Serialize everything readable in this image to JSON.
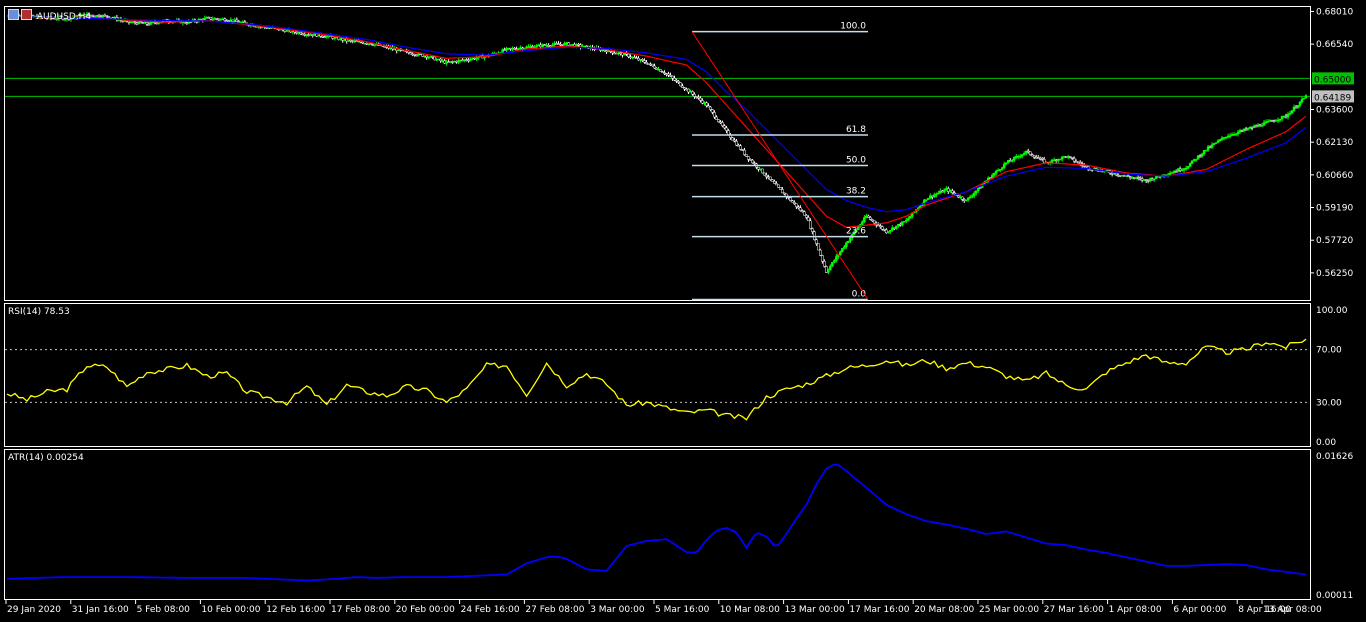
{
  "window": {
    "symbol_title": "AUDUSD,H4"
  },
  "colors": {
    "background": "#000000",
    "bull_candle": "#00ff00",
    "bear_candle": "#ffffff",
    "ma_fast": "#ff0000",
    "ma_slow": "#0000ff",
    "fib_lines": "#c0e0f0",
    "price_level_lines": "#00c000",
    "rsi_line": "#ffff00",
    "atr_line": "#0000ff",
    "frame": "#ffffff"
  },
  "price_badges": [
    {
      "label": "0.65000",
      "bg": "#00c000",
      "fg": "#000000",
      "value": 0.65
    },
    {
      "label": "0.64189",
      "bg": "#c0c0c0",
      "fg": "#000000",
      "value": 0.64189
    }
  ],
  "fibonacci": {
    "levels": [
      {
        "label": "100.0",
        "value": 0.671
      },
      {
        "label": "61.8",
        "value": 0.6245
      },
      {
        "label": "50.0",
        "value": 0.6108
      },
      {
        "label": "38.2",
        "value": 0.5968
      },
      {
        "label": "23.6",
        "value": 0.5788
      },
      {
        "label": "0.0",
        "value": 0.5505
      }
    ]
  },
  "rsi_panel": {
    "title": "RSI(14) 78.53",
    "levels_dashed": [
      70,
      30
    ]
  },
  "atr_panel": {
    "title": "ATR(14) 0.00254"
  },
  "chart_data": [
    {
      "type": "line",
      "title": "AUDUSD,H4",
      "description_series": "candlestick price with two moving averages",
      "ylim": [
        0.5503,
        0.6821
      ],
      "y_ticks": [
        "0.68010",
        "0.66540",
        "0.63600",
        "0.62130",
        "0.60660",
        "0.59190",
        "0.57720",
        "0.56250"
      ],
      "x_ticks": [
        "29 Jan 2020",
        "31 Jan 16:00",
        "5 Feb 08:00",
        "10 Feb 00:00",
        "12 Feb 16:00",
        "17 Feb 08:00",
        "20 Feb 00:00",
        "24 Feb 16:00",
        "27 Feb 08:00",
        "3 Mar 00:00",
        "5 Mar 16:00",
        "10 Mar 08:00",
        "13 Mar 00:00",
        "17 Mar 16:00",
        "20 Mar 08:00",
        "25 Mar 00:00",
        "27 Mar 16:00",
        "1 Apr 08:00",
        "6 Apr 00:00",
        "8 Apr 16:00",
        "13 Apr 08:00"
      ],
      "series": [
        {
          "role": "close",
          "x": [
            0,
            10,
            20,
            30,
            40,
            50,
            60,
            70,
            80,
            90,
            100,
            110,
            120,
            130,
            140,
            150,
            160,
            170,
            180,
            190,
            200,
            210,
            220,
            230,
            240,
            250,
            260,
            270,
            280,
            290,
            300,
            310,
            320,
            330,
            340,
            350,
            360,
            370,
            380,
            390,
            400,
            410,
            420,
            430,
            440,
            450,
            460,
            470,
            480,
            490,
            500,
            510,
            520,
            530,
            540,
            550,
            560,
            570,
            580,
            590,
            600,
            610,
            620,
            630,
            640,
            650
          ],
          "values": [
            0.6785,
            0.6778,
            0.6772,
            0.677,
            0.6785,
            0.678,
            0.6755,
            0.6745,
            0.676,
            0.6752,
            0.677,
            0.6765,
            0.6745,
            0.673,
            0.6715,
            0.67,
            0.669,
            0.667,
            0.666,
            0.664,
            0.6618,
            0.66,
            0.657,
            0.6585,
            0.66,
            0.663,
            0.664,
            0.665,
            0.6655,
            0.664,
            0.6625,
            0.6605,
            0.657,
            0.652,
            0.645,
            0.638,
            0.626,
            0.615,
            0.606,
            0.597,
            0.588,
            0.563,
            0.576,
            0.588,
            0.581,
            0.586,
            0.596,
            0.6,
            0.595,
            0.604,
            0.612,
            0.617,
            0.612,
            0.615,
            0.61,
            0.608,
            0.606,
            0.604,
            0.607,
            0.61,
            0.618,
            0.624,
            0.627,
            0.63,
            0.633,
            0.6419
          ]
        },
        {
          "role": "ma_fast",
          "x": [
            0,
            20,
            40,
            60,
            80,
            100,
            120,
            140,
            160,
            180,
            200,
            220,
            240,
            260,
            280,
            300,
            320,
            340,
            350,
            360,
            370,
            380,
            390,
            400,
            410,
            420,
            430,
            440,
            450,
            460,
            480,
            500,
            520,
            540,
            560,
            580,
            600,
            620,
            640,
            650
          ],
          "values": [
            0.6778,
            0.6772,
            0.6775,
            0.6762,
            0.6752,
            0.676,
            0.6742,
            0.672,
            0.6695,
            0.6665,
            0.6625,
            0.659,
            0.6598,
            0.6632,
            0.6645,
            0.663,
            0.66,
            0.656,
            0.648,
            0.638,
            0.628,
            0.618,
            0.608,
            0.598,
            0.588,
            0.583,
            0.584,
            0.585,
            0.588,
            0.593,
            0.599,
            0.608,
            0.612,
            0.611,
            0.6075,
            0.606,
            0.609,
            0.618,
            0.626,
            0.633
          ]
        },
        {
          "role": "ma_slow",
          "x": [
            0,
            20,
            40,
            60,
            80,
            100,
            120,
            140,
            160,
            180,
            200,
            220,
            240,
            260,
            280,
            300,
            320,
            340,
            350,
            360,
            370,
            380,
            390,
            400,
            410,
            420,
            430,
            440,
            450,
            460,
            480,
            500,
            520,
            540,
            560,
            580,
            600,
            620,
            640,
            650
          ],
          "values": [
            0.6775,
            0.6775,
            0.677,
            0.6765,
            0.676,
            0.6758,
            0.6745,
            0.6725,
            0.67,
            0.6675,
            0.664,
            0.661,
            0.6605,
            0.6625,
            0.664,
            0.6635,
            0.6615,
            0.6585,
            0.653,
            0.644,
            0.636,
            0.627,
            0.618,
            0.609,
            0.6,
            0.595,
            0.592,
            0.59,
            0.591,
            0.594,
            0.599,
            0.606,
            0.61,
            0.6095,
            0.607,
            0.606,
            0.608,
            0.614,
            0.621,
            0.628
          ]
        }
      ]
    },
    {
      "type": "line",
      "title": "RSI(14) 78.53",
      "ylim": [
        0,
        100
      ],
      "y_ticks": [
        "100.00",
        "70.00",
        "30.00",
        "0.00"
      ],
      "series": [
        {
          "name": "RSI(14)",
          "x": [
            0,
            10,
            20,
            30,
            40,
            50,
            60,
            70,
            80,
            90,
            100,
            110,
            120,
            130,
            140,
            150,
            160,
            170,
            180,
            190,
            200,
            210,
            220,
            230,
            240,
            250,
            260,
            270,
            280,
            290,
            300,
            310,
            320,
            330,
            340,
            350,
            360,
            370,
            380,
            390,
            400,
            410,
            420,
            430,
            440,
            450,
            460,
            470,
            480,
            490,
            500,
            510,
            520,
            530,
            540,
            550,
            560,
            570,
            580,
            590,
            600,
            610,
            620,
            630,
            640,
            650
          ],
          "values": [
            37,
            32,
            38,
            40,
            58,
            57,
            42,
            53,
            55,
            58,
            50,
            52,
            38,
            34,
            30,
            42,
            28,
            43,
            38,
            35,
            42,
            39,
            30,
            40,
            58,
            58,
            36,
            60,
            43,
            52,
            44,
            28,
            30,
            26,
            22,
            24,
            20,
            18,
            34,
            40,
            44,
            50,
            56,
            58,
            62,
            58,
            62,
            56,
            60,
            57,
            50,
            46,
            52,
            43,
            40,
            53,
            60,
            66,
            60,
            60,
            72,
            68,
            70,
            76,
            72,
            78
          ]
        }
      ]
    },
    {
      "type": "line",
      "title": "ATR(14) 0.00254",
      "ylim": [
        0,
        0.01626
      ],
      "y_ticks": [
        "0.01626",
        "0.00011"
      ],
      "series": [
        {
          "name": "ATR(14)",
          "x": [
            0,
            30,
            60,
            90,
            120,
            150,
            165,
            175,
            185,
            200,
            220,
            250,
            260,
            270,
            275,
            280,
            290,
            300,
            310,
            320,
            330,
            340,
            345,
            350,
            355,
            360,
            365,
            370,
            375,
            380,
            385,
            390,
            395,
            400,
            405,
            410,
            415,
            420,
            430,
            440,
            450,
            460,
            470,
            480,
            490,
            500,
            510,
            520,
            530,
            540,
            550,
            560,
            570,
            580,
            590,
            600,
            610,
            620,
            630,
            640,
            650
          ],
          "values": [
            0.002,
            0.0022,
            0.0022,
            0.0021,
            0.0021,
            0.0018,
            0.002,
            0.0022,
            0.0021,
            0.0022,
            0.0022,
            0.0025,
            0.0038,
            0.0045,
            0.0046,
            0.0043,
            0.0031,
            0.0029,
            0.0058,
            0.0064,
            0.0066,
            0.0051,
            0.005,
            0.0065,
            0.0076,
            0.0079,
            0.0074,
            0.0056,
            0.0074,
            0.0069,
            0.0056,
            0.0072,
            0.009,
            0.0106,
            0.013,
            0.0148,
            0.0154,
            0.0145,
            0.0126,
            0.0106,
            0.0095,
            0.0087,
            0.0083,
            0.0078,
            0.0072,
            0.0075,
            0.0068,
            0.0061,
            0.0059,
            0.0054,
            0.005,
            0.0045,
            0.004,
            0.0035,
            0.0035,
            0.0036,
            0.0037,
            0.0036,
            0.0031,
            0.0028,
            0.0025
          ]
        }
      ]
    }
  ]
}
